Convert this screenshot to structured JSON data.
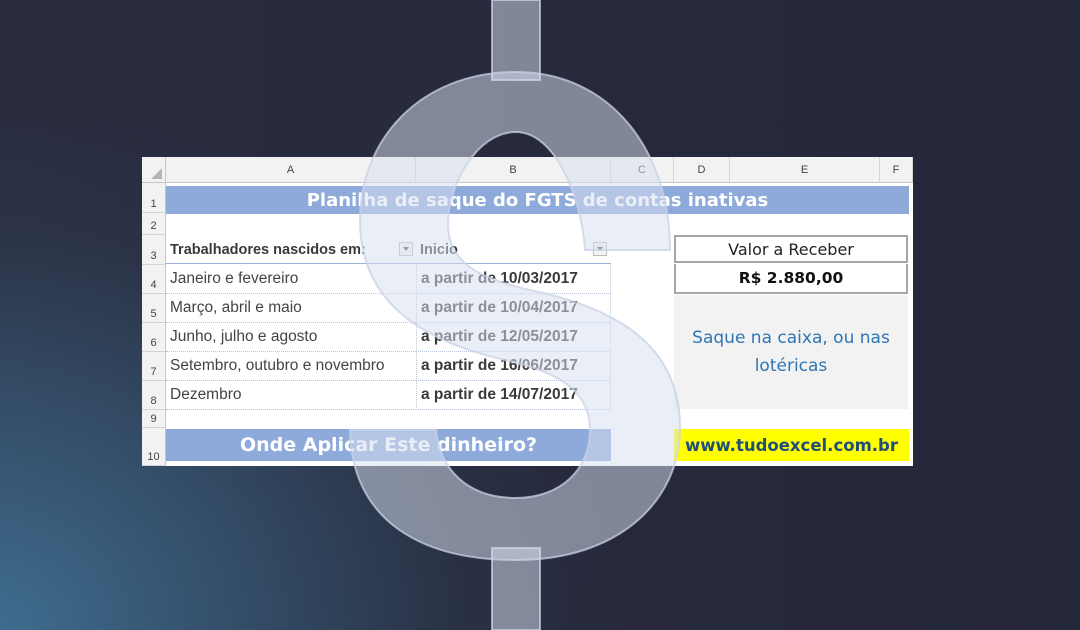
{
  "columns": [
    "A",
    "B",
    "C",
    "D",
    "E",
    "F"
  ],
  "rows": [
    "1",
    "2",
    "3",
    "4",
    "5",
    "6",
    "7",
    "8",
    "9",
    "10"
  ],
  "title": "Planilha de saque do FGTS de contas inativas",
  "table": {
    "headers": [
      "Trabalhadores nascidos em:",
      "Inicio"
    ],
    "rows": [
      {
        "birth": "Janeiro e fevereiro",
        "start": "a partir de 10/03/2017"
      },
      {
        "birth": "Março, abril e maio",
        "start": "a partir de 10/04/2017"
      },
      {
        "birth": "Junho, julho e agosto",
        "start": "a partir de 12/05/2017"
      },
      {
        "birth": "Setembro, outubro e novembro",
        "start": "a partir de 16/06/2017"
      },
      {
        "birth": "Dezembro",
        "start": "a partir de 14/07/2017"
      }
    ]
  },
  "summary": {
    "label": "Valor a Receber",
    "value": "R$ 2.880,00",
    "note": "Saque na caixa, ou nas lotéricas"
  },
  "bottom_banner": "Onde Aplicar Este dinheiro?",
  "website": "www.tudoexcel.com.br",
  "icons": [
    "dropdown-arrow-icon",
    "dollar-sign-icon",
    "select-all-triangle-icon"
  ],
  "colors": {
    "banner": "#8eaadb",
    "website_highlight": "#ffff00",
    "note_text": "#2e75b6"
  }
}
